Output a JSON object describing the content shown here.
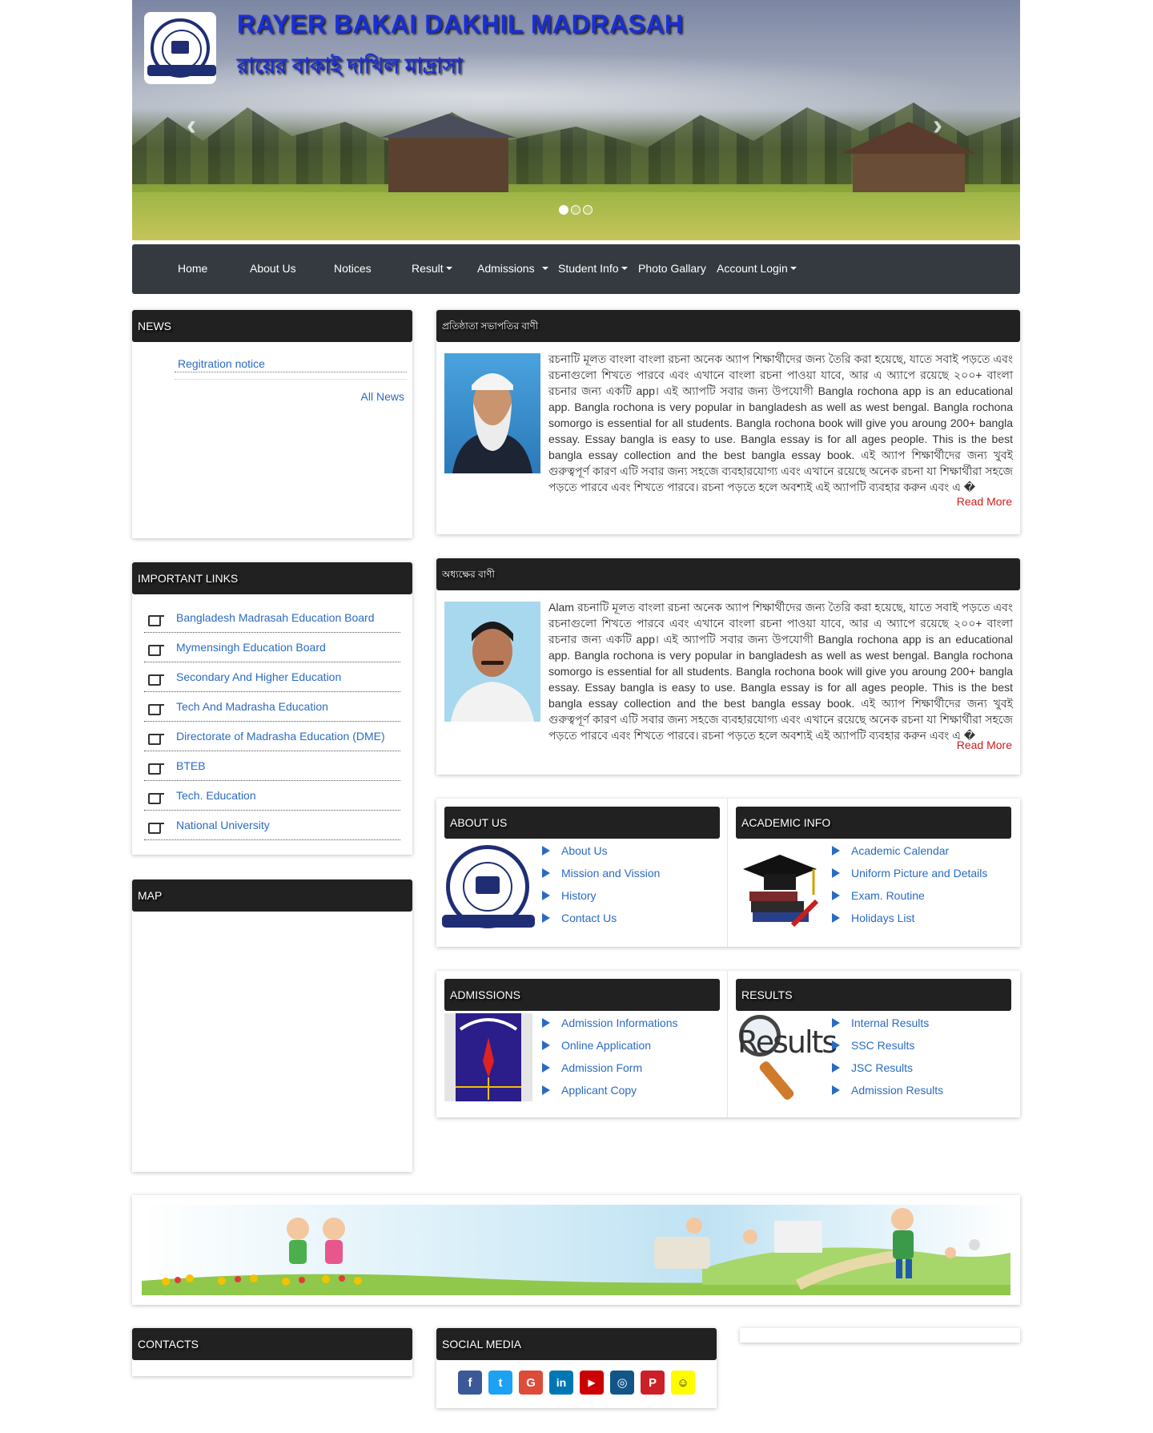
{
  "header": {
    "title": "RAYER BAKAI DAKHIL MADRASAH",
    "subtitle": "রায়ের বাকাই দাখিল মাদ্রাসা",
    "prev_arrow": "‹",
    "next_arrow": "›",
    "slide_count": 3,
    "active_slide": 1
  },
  "nav": {
    "items": [
      {
        "label": "Home"
      },
      {
        "label": "About Us"
      },
      {
        "label": "Notices"
      },
      {
        "label": "Result"
      },
      {
        "label": "Admissions"
      },
      {
        "label": "Student Info"
      },
      {
        "label": "Photo Gallary"
      },
      {
        "label": "Account Login"
      }
    ]
  },
  "news": {
    "heading": "NEWS",
    "items": [
      "Regitration notice"
    ],
    "all_news": "All News"
  },
  "important_links": {
    "heading": "IMPORTANT LINKS",
    "items": [
      "Bangladesh Madrasah Education Board",
      "Mymensingh Education Board",
      "Secondary And Higher Education",
      "Tech And Madrasha Education",
      "Directorate of Madrasha Education (DME)",
      "BTEB",
      "Tech. Education",
      "National University"
    ]
  },
  "map": {
    "heading": "MAP"
  },
  "message1": {
    "heading": "প্রতিষ্ঠাতা সভাপতির বাণী",
    "text": "রচনাটি মূলত বাংলা বাংলা রচনা অনেক অ্যাপ শিক্ষার্থীদের জন্য তৈরি করা হয়েছে, যাতে সবাই পড়তে এবং রচনাগুলো শিখতে পারবে এবং এখানে বাংলা রচনা পাওয়া যাবে, আর এ অ্যাপে রয়েছে ২০০+ বাংলা রচনার জন্য একটি app। এই অ্যাপটি সবার জন্য উপযোগী Bangla rochona app is an educational app. Bangla rochona is very popular in bangladesh as well as west bengal. Bangla rochona somorgo is essential for all students. Bangla rochona book will give you aroung 200+ bangla essay. Essay bangla is easy to use. Bangla essay is for all ages people. This is the best bangla essay collection and the best bangla essay book. এই অ্যাপ শিক্ষার্থীদের জন্য খুবই গুরুত্বপূর্ণ কারণ এটি সবার জন্য সহজে ব্যবহারযোগ্য এবং এখানে রয়েছে অনেক রচনা যা শিক্ষার্থীরা সহজে পড়তে পারবে এবং শিখতে পারবে। রচনা পড়তে হলে অবশ্যই এই অ্যাপটি ব্যবহার করুন এবং এ �",
    "read_more": "Read More"
  },
  "message2": {
    "heading": "অধ্যক্ষের বাণী",
    "text": "Alam রচনাটি মূলত বাংলা রচনা অনেক অ্যাপ শিক্ষার্থীদের জন্য তৈরি করা হয়েছে, যাতে সবাই পড়তে এবং রচনাগুলো শিখতে পারবে এবং এখানে বাংলা রচনা পাওয়া যাবে, আর এ অ্যাপে রয়েছে ২০০+ বাংলা রচনার জন্য একটি app। এই অ্যাপটি সবার জন্য উপযোগী Bangla rochona app is an educational app. Bangla rochona is very popular in bangladesh as well as west bengal. Bangla rochona somorgo is essential for all students. Bangla rochona book will give you aroung 200+ bangla essay. Essay bangla is easy to use. Bangla essay is for all ages people. This is the best bangla essay collection and the best bangla essay book. এই অ্যাপ শিক্ষার্থীদের জন্য খুবই গুরুত্বপূর্ণ কারণ এটি সবার জন্য সহজে ব্যবহারযোগ্য এবং এখানে রয়েছে অনেক রচনা যা শিক্ষার্থীরা সহজে পড়তে পারবে এবং শিখতে পারবে। রচনা পড়তে হলে অবশ্যই এই অ্যাপটি ব্যবহার করুন এবং এ �",
    "read_more": "Read More"
  },
  "about_us": {
    "heading": "ABOUT US",
    "items": [
      "About Us",
      "Mission and Vission",
      "History",
      "Contact Us"
    ]
  },
  "academic_info": {
    "heading": "ACADEMIC INFO",
    "items": [
      "Academic Calendar",
      "Uniform Picture and Details",
      "Exam. Routine",
      "Holidays List"
    ]
  },
  "admissions": {
    "heading": "ADMISSIONS",
    "items": [
      "Admission Informations",
      "Online Application",
      "Admission Form",
      "Applicant Copy"
    ]
  },
  "results": {
    "heading": "RESULTS",
    "image_text": "Results",
    "items": [
      "Internal Results",
      "SSC Results",
      "JSC Results",
      "Admission Results"
    ]
  },
  "contacts": {
    "heading": "CONTACTS"
  },
  "social_media": {
    "heading": "SOCIAL MEDIA",
    "icons": [
      {
        "name": "facebook-icon",
        "glyph": "f",
        "color": "#3b5998"
      },
      {
        "name": "twitter-icon",
        "glyph": "t",
        "color": "#1da1f2"
      },
      {
        "name": "google-icon",
        "glyph": "G",
        "color": "#dd4b39"
      },
      {
        "name": "linkedin-icon",
        "glyph": "in",
        "color": "#0077b5"
      },
      {
        "name": "youtube-icon",
        "glyph": "▶",
        "color": "#cc0000"
      },
      {
        "name": "instagram-icon",
        "glyph": "◎",
        "color": "#125688"
      },
      {
        "name": "pinterest-icon",
        "glyph": "P",
        "color": "#cb2027"
      },
      {
        "name": "snapchat-icon",
        "glyph": "☺",
        "color": "#fffc00"
      }
    ]
  }
}
